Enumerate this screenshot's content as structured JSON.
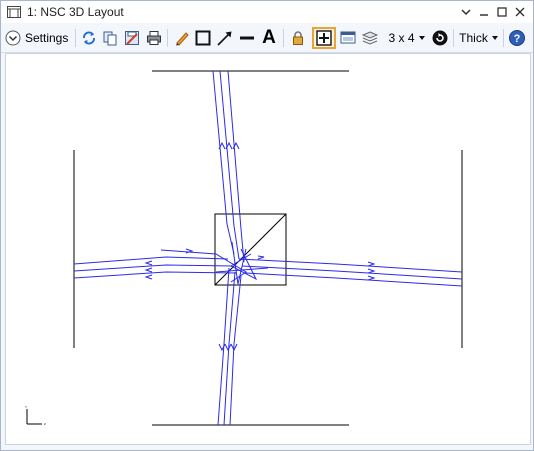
{
  "window": {
    "title": "1: NSC 3D Layout",
    "controls": [
      "chevron-down",
      "minimize",
      "maximize",
      "close"
    ]
  },
  "toolbar": {
    "settings_label": "Settings",
    "grid_label": "3 x 4",
    "thickness_label": "Thick",
    "text_tool_label": "A",
    "icons": [
      "refresh-icon",
      "copy-icon",
      "save-icon",
      "print-icon",
      "pencil-icon",
      "rectangle-icon",
      "arrow-icon",
      "line-icon",
      "text-icon",
      "lock-icon",
      "fit-view-icon",
      "window-icon",
      "layers-icon",
      "grid-icon",
      "rotate-icon",
      "help-icon"
    ]
  },
  "canvas": {
    "axis_y_label": "Y",
    "axis_z_label": "Z",
    "colors": {
      "ray": "#2a2aee",
      "geometry": "#000000"
    }
  }
}
